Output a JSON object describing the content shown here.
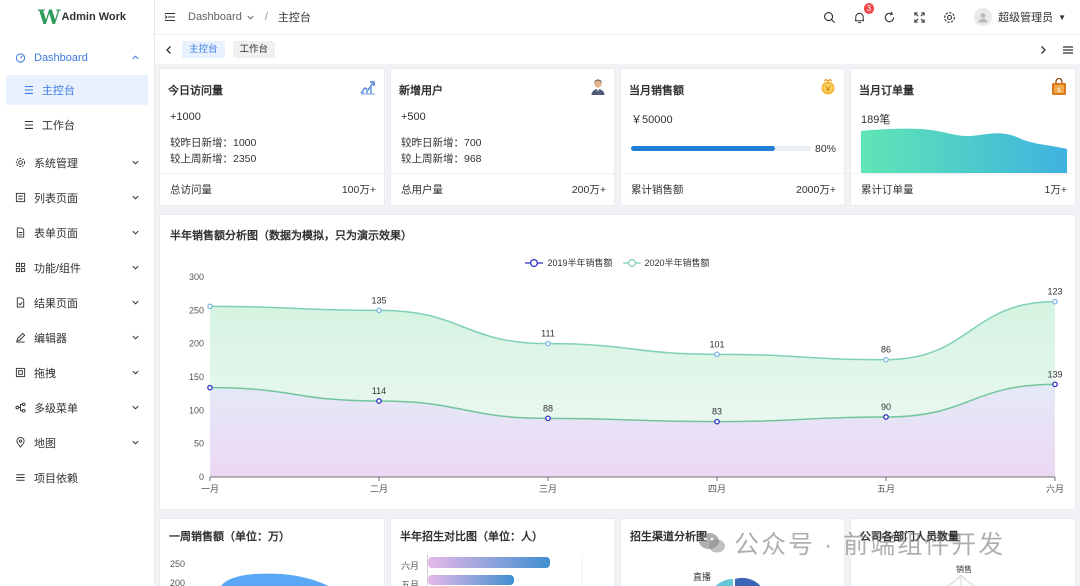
{
  "app": {
    "logo_mark": "W",
    "logo_text": "Admin Work"
  },
  "sidebar": {
    "items": [
      {
        "label": "Dashboard",
        "icon": "dashboard-icon",
        "expanded": true,
        "children": [
          {
            "label": "主控台",
            "active": true
          },
          {
            "label": "工作台",
            "active": false
          }
        ]
      },
      {
        "label": "系统管理",
        "icon": "gear-icon"
      },
      {
        "label": "列表页面",
        "icon": "list-icon"
      },
      {
        "label": "表单页面",
        "icon": "form-icon"
      },
      {
        "label": "功能/组件",
        "icon": "grid-icon"
      },
      {
        "label": "结果页面",
        "icon": "result-icon"
      },
      {
        "label": "编辑器",
        "icon": "edit-icon"
      },
      {
        "label": "拖拽",
        "icon": "drag-icon"
      },
      {
        "label": "多级菜单",
        "icon": "tree-icon"
      },
      {
        "label": "地图",
        "icon": "location-icon"
      },
      {
        "label": "项目依赖",
        "icon": "menu-icon"
      }
    ]
  },
  "header": {
    "breadcrumb_parent": "Dashboard",
    "breadcrumb_sep": "/",
    "breadcrumb_current": "主控台",
    "notification_count": "3",
    "username": "超级管理员"
  },
  "tabs": [
    {
      "label": "主控台",
      "active": true
    },
    {
      "label": "工作台",
      "active": false
    }
  ],
  "stats": {
    "visits": {
      "title": "今日访问量",
      "value": "+1000",
      "line1": "较昨日新增：1000",
      "line2": "较上周新增：2350",
      "foot_label": "总访问量",
      "foot_value": "100万+"
    },
    "users": {
      "title": "新增用户",
      "value": "+500",
      "line1": "较昨日新增：700",
      "line2": "较上周新增：968",
      "foot_label": "总用户量",
      "foot_value": "200万+"
    },
    "sales": {
      "title": "当月销售额",
      "value": "￥50000",
      "progress": 0.8,
      "progress_text": "80%",
      "foot_label": "累计销售额",
      "foot_value": "2000万+"
    },
    "orders": {
      "title": "当月订单量",
      "value": "189笔",
      "foot_label": "累计订单量",
      "foot_value": "1万+"
    }
  },
  "chart_data": {
    "type": "line",
    "title": "半年销售额分析图（数据为模拟，只为演示效果）",
    "categories": [
      "一月",
      "二月",
      "三月",
      "四月",
      "五月",
      "六月"
    ],
    "ylim": [
      0,
      300
    ],
    "yticks": [
      0,
      50,
      100,
      150,
      200,
      250,
      300
    ],
    "series": [
      {
        "name": "2019半年销售额",
        "values": [
          134,
          114,
          88,
          83,
          90,
          139
        ],
        "labels": [
          "",
          "114",
          "88",
          "83",
          "90",
          "139"
        ],
        "color": "#2f33c4"
      },
      {
        "name": "2020半年销售额",
        "values": [
          256,
          250,
          200,
          184,
          176,
          263
        ],
        "labels": [
          "",
          "135",
          "111",
          "101",
          "86",
          "123"
        ],
        "color": "#80d0b8"
      }
    ],
    "grid": false,
    "legend": "top-center"
  },
  "bottom_cards": [
    {
      "title": "一周销售额（单位：万）",
      "yticks": [
        "250",
        "200"
      ]
    },
    {
      "title": "半年招生对比图（单位：人）",
      "ticks": [
        "六月",
        "五月"
      ]
    },
    {
      "title": "招生渠道分析图",
      "label": "直播"
    },
    {
      "title": "公司各部门人员数量",
      "label": "销售"
    }
  ],
  "watermark": "公众号 · 前端组件开发",
  "colors": {
    "accent": "#3d7ae0",
    "progress": "#1f7fd6",
    "badge": "#f04848"
  }
}
